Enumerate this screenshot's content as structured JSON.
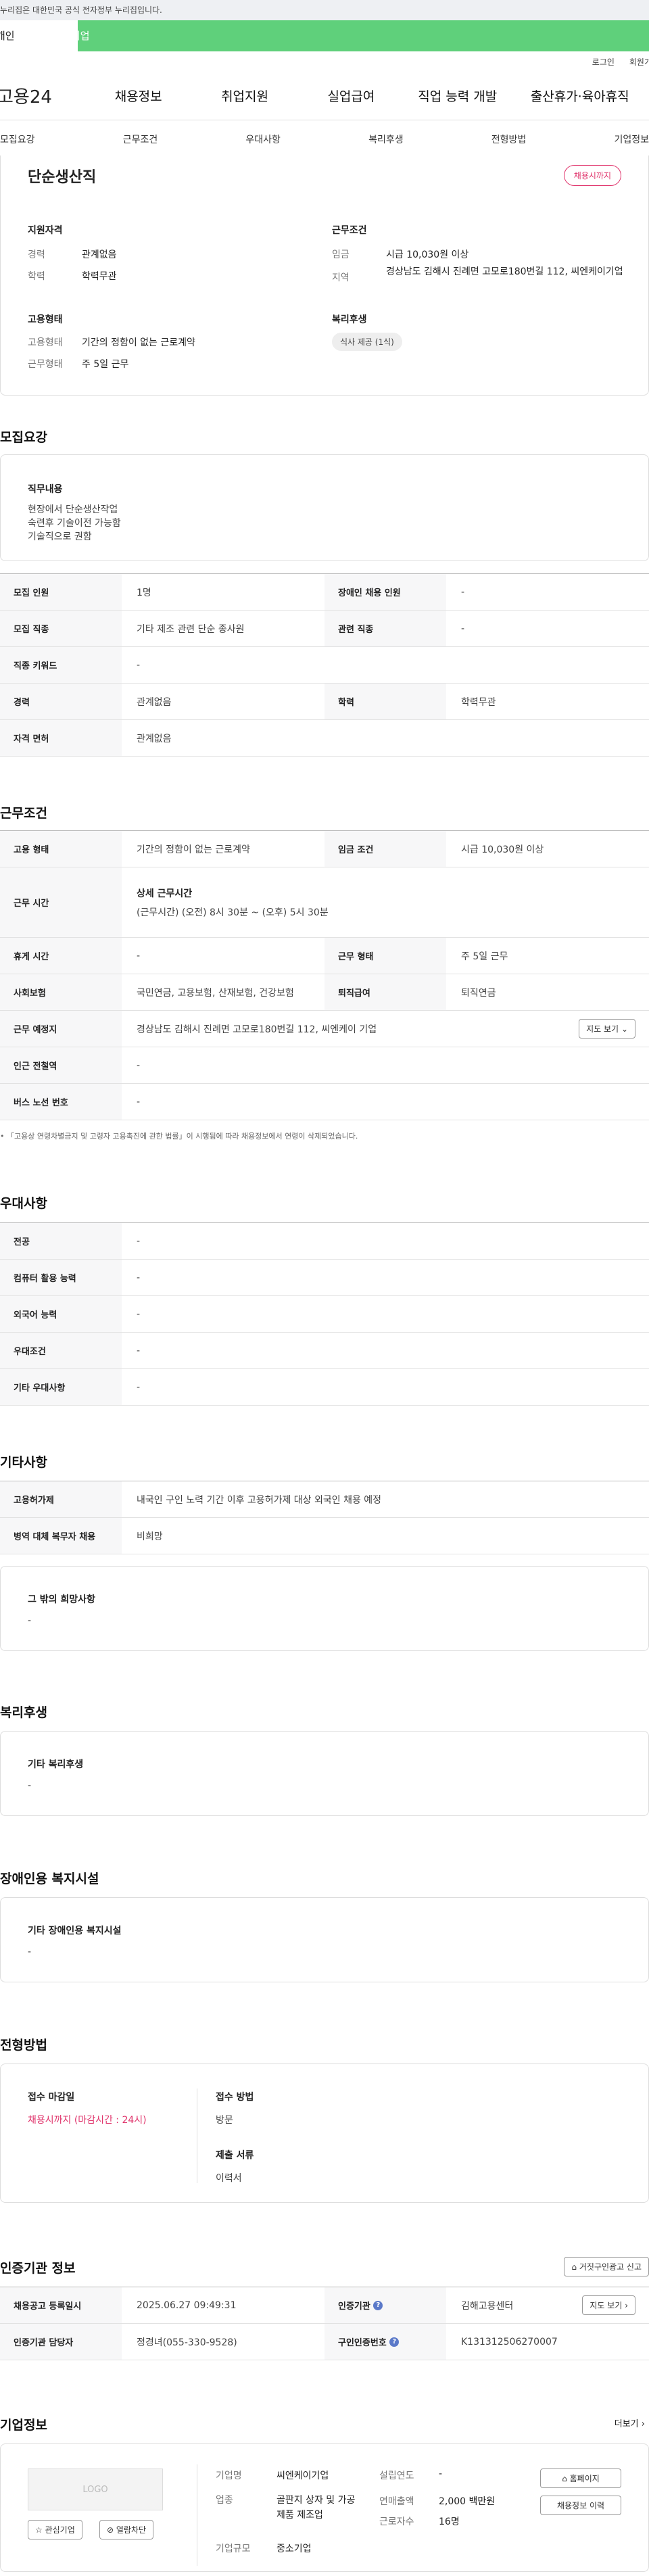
{
  "gov_notice": "이 누리집은 대한민국 공식 전자정부 누리집입니다.",
  "gov_notice_visible": "누리집은 대한민국 공식 전자정부 누리집입니다.",
  "tabs": [
    "개인",
    "기업"
  ],
  "util": [
    "로그인",
    "회원가"
  ],
  "site_logo": "고용24",
  "nav": [
    "채용정보",
    "취업지원",
    "실업급여",
    "직업 능력 개발",
    "출산휴가·육아휴직"
  ],
  "subnav": [
    "모집요강",
    "근무조건",
    "우대사항",
    "복리후생",
    "전형방법",
    "기업정보"
  ],
  "job": {
    "title": "단순생산직",
    "status": "채용시까지",
    "qual_title": "지원자격",
    "exp_l": "경력",
    "exp_v": "관계없음",
    "edu_l": "학력",
    "edu_v": "학력무관",
    "emp_title": "고용형태",
    "emp_l": "고용형태",
    "emp_v": "기간의 정함이 없는 근로계약",
    "work_l": "근무형태",
    "work_v": "주 5일 근무",
    "cond_title": "근무조건",
    "wage_l": "임금",
    "wage_v": "시급 10,030원 이상",
    "area_l": "지역",
    "area_v": "경상남도 김해시 진례면 고모로180번길 112, 씨엔케이기업",
    "welfare_title": "복리후생",
    "welfare_badge": "식사 제공 (1식)"
  },
  "recruit": {
    "title": "모집요강",
    "duty_title": "직무내용",
    "duty_lines": [
      "현장에서 단순생산작업",
      "숙련후 기술이전 가능함",
      "기술직으로 권함"
    ],
    "rows": [
      [
        "모집 인원",
        "1명",
        "장애인 채용 인원",
        "-"
      ],
      [
        "모집 직종",
        "기타 제조 관련 단순 종사원",
        "관련 직종",
        "-"
      ],
      [
        "직종 키워드",
        "-"
      ],
      [
        "경력",
        "관계없음",
        "학력",
        "학력무관"
      ],
      [
        "자격 면허",
        "관계없음"
      ]
    ]
  },
  "work": {
    "title": "근무조건",
    "emp_l": "고용 형태",
    "emp_v": "기간의 정함이 없는 근로계약",
    "wage_l": "임금 조건",
    "wage_v": "시급 10,030원 이상",
    "time_l": "근무 시간",
    "time_head": "상세 근무시간",
    "time_v": "(근무시간) (오전) 8시 30분 ~ (오후) 5시 30분",
    "rest_l": "휴게 시간",
    "rest_v": "-",
    "form_l": "근무 형태",
    "form_v": "주 5일 근무",
    "ins_l": "사회보험",
    "ins_v": "국민연금, 고용보험, 산재보험, 건강보험",
    "sev_l": "퇴직급여",
    "sev_v": "퇴직연금",
    "place_l": "근무 예정지",
    "place_v": "경상남도 김해시 진례면 고모로180번길 112, 씨엔케이 기업",
    "map_btn": "지도 보기",
    "sub_l": "인근 전철역",
    "sub_v": "-",
    "bus_l": "버스 노선 번호",
    "bus_v": "-",
    "note": "「고용상 연령차별금지 및 고령자 고용촉진에 관한 법률」이 시행됨에 따라 채용정보에서 연령이 삭제되었습니다."
  },
  "pref": {
    "title": "우대사항",
    "rows": [
      [
        "전공",
        "-"
      ],
      [
        "컴퓨터 활용 능력",
        "-"
      ],
      [
        "외국어 능력",
        "-"
      ],
      [
        "우대조건",
        "-"
      ],
      [
        "기타 우대사항",
        "-"
      ]
    ]
  },
  "etc": {
    "title": "기타사항",
    "rows": [
      [
        "고용허가제",
        "내국인 구인 노력 기간 이후 고용허가제 대상 외국인 채용 예정"
      ],
      [
        "병역 대체 복무자 채용",
        "비희망"
      ]
    ],
    "other_title": "그 밖의 희망사항",
    "other_v": "-"
  },
  "benefit": {
    "title": "복리후생",
    "sub": "기타 복리후생",
    "v": "-"
  },
  "disab": {
    "title": "장애인용 복지시설",
    "sub": "기타 장애인용 복지시설",
    "v": "-"
  },
  "select": {
    "title": "전형방법",
    "deadline_l": "접수 마감일",
    "deadline_v": "채용시까지 (마감시간 : 24시)",
    "method_l": "접수 방법",
    "method_v": "방문",
    "docs_l": "제출 서류",
    "docs_v": "이력서"
  },
  "cert": {
    "title": "인증기관 정보",
    "report_btn": "거짓구인광고 신고",
    "reg_l": "채용공고 등록일시",
    "reg_v": "2025.06.27 09:49:31",
    "org_l": "인증기관",
    "org_v": "김해고용센터",
    "map_btn": "지도 보기",
    "mgr_l": "인증기관 담당자",
    "mgr_v": "정경녀(055-330-9528)",
    "no_l": "구인인증번호",
    "no_v": "K131312506270007"
  },
  "company": {
    "title": "기업정보",
    "more": "더보기",
    "logo": "LOGO",
    "fav_btn": "관심기업",
    "block_btn": "열람차단",
    "name_l": "기업명",
    "name_v": "씨엔케이기업",
    "ind_l": "업종",
    "ind_v": "골판지 상자 및 가공제품 제조업",
    "size_l": "기업규모",
    "size_v": "중소기업",
    "year_l": "설립연도",
    "year_v": "-",
    "sales_l": "연매출액",
    "sales_v": "2,000 백만원",
    "emp_l": "근로자수",
    "emp_v": "16명",
    "home_btn": "홈페이지",
    "hist_btn": "채용정보 이력"
  }
}
